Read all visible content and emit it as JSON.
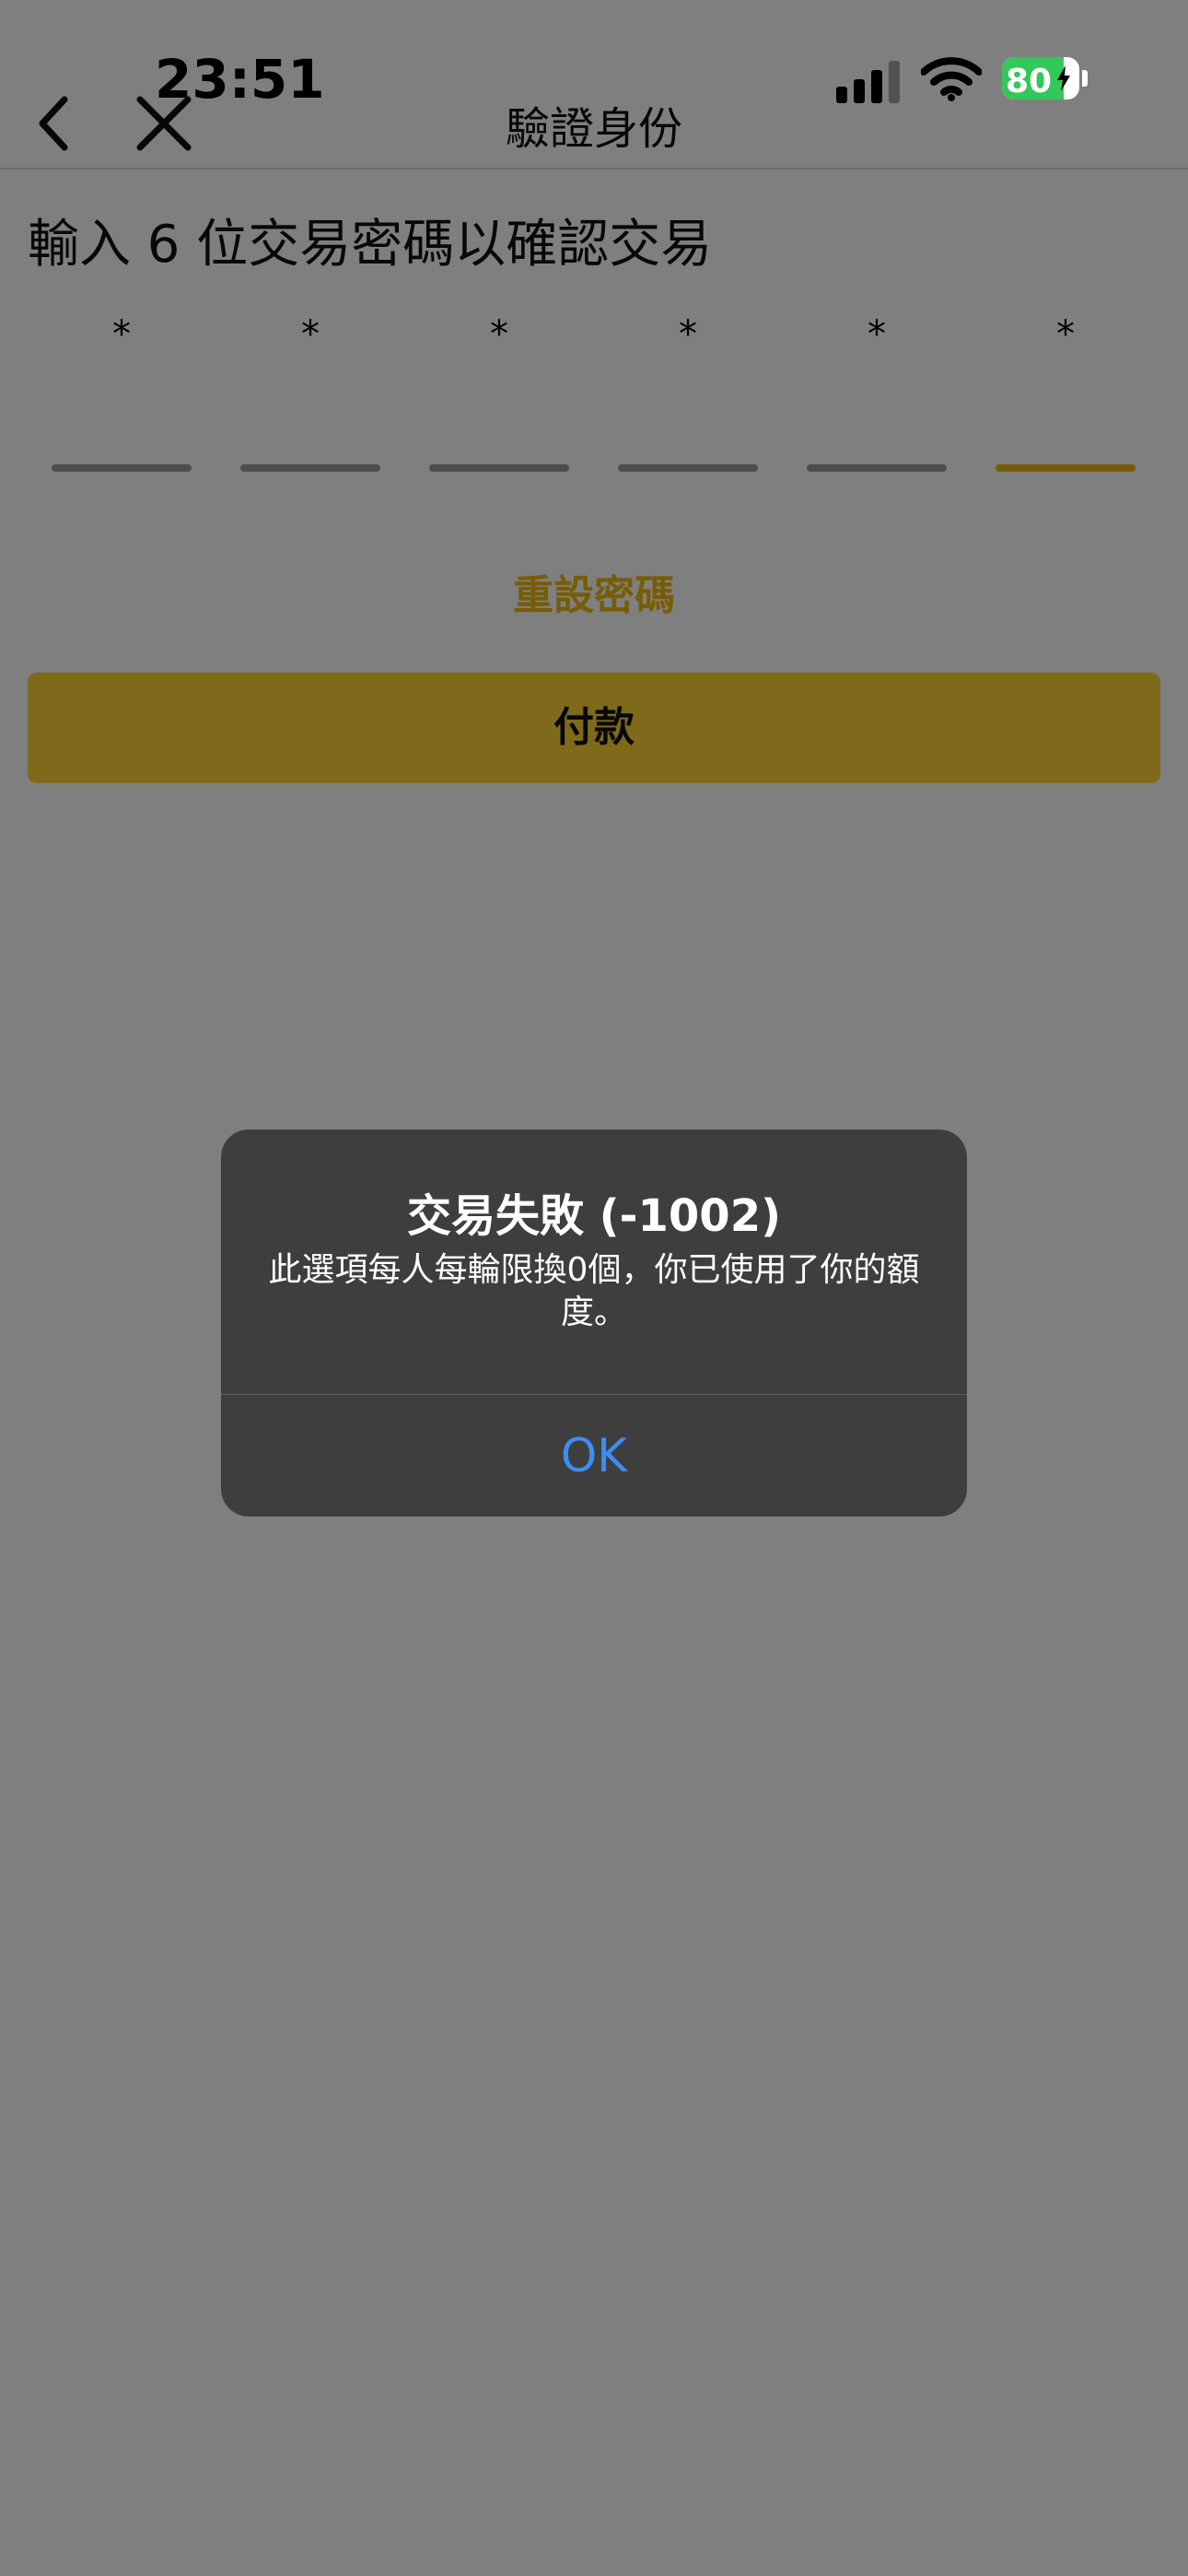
{
  "status_bar": {
    "time": "23:51",
    "battery_percent": "80",
    "battery_level": 0.8,
    "signal_icon": "cellular-signal-icon",
    "wifi_icon": "wifi-icon",
    "charging_icon": "bolt-icon"
  },
  "nav": {
    "title": "驗證身份",
    "back_icon": "chevron-left-icon",
    "close_icon": "close-icon"
  },
  "form": {
    "prompt": "輸入 6 位交易密碼以確認交易",
    "pin_characters": [
      "*",
      "*",
      "*",
      "*",
      "*",
      "*"
    ],
    "reset_link": "重設密碼",
    "pay_button": "付款"
  },
  "alert": {
    "title": "交易失敗 (-1002)",
    "message": "此選項每人每輪限換0個，你已使用了你的額度。",
    "ok_button": "OK"
  },
  "colors": {
    "accent": "#f0b90b",
    "button": "#fcd535",
    "alert_bg": "#3e3e3e",
    "alert_action": "#3b8ef5",
    "battery": "#34c759"
  }
}
